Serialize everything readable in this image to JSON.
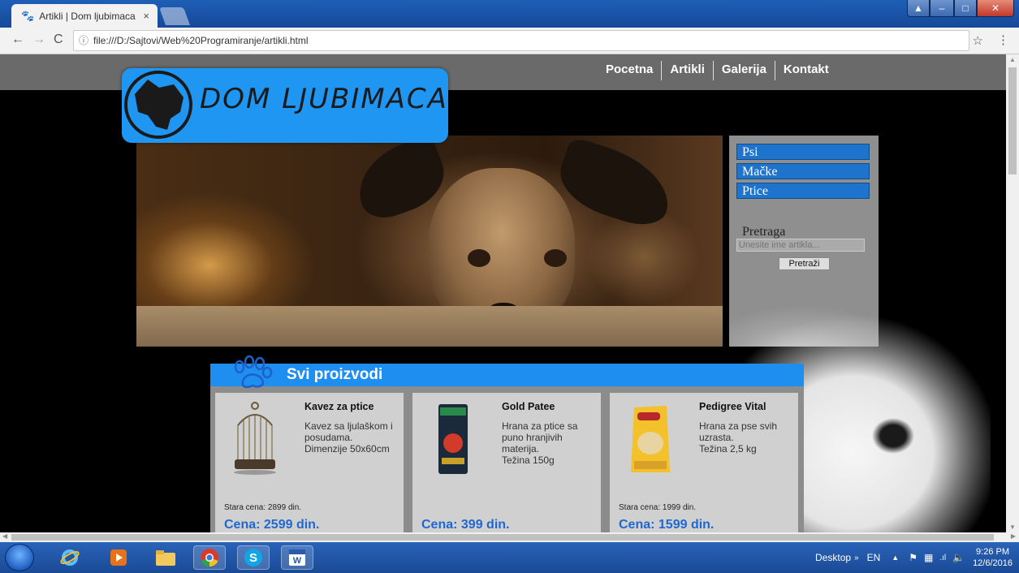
{
  "browser": {
    "tab_title": "Artikli | Dom ljubimaca",
    "url": "file:///D:/Sajtovi/Web%20Programiranje/artikli.html"
  },
  "site": {
    "nav": [
      {
        "label": "Pocetna"
      },
      {
        "label": "Artikli"
      },
      {
        "label": "Galerija"
      },
      {
        "label": "Kontakt"
      }
    ],
    "logo_text": "DOM LJUBIMACA",
    "categories": [
      {
        "label": "Psi"
      },
      {
        "label": "Mačke"
      },
      {
        "label": "Ptice"
      }
    ],
    "search": {
      "label": "Pretraga",
      "placeholder": "Unesite ime artikla...",
      "button": "Pretraži"
    },
    "products_title": "Svi proizvodi",
    "products": [
      {
        "name": "Kavez za ptice",
        "description": "Kavez sa ljulaškom i posudama.\nDimenzije 50x60cm",
        "old_price": "Stara cena: 2899 din.",
        "price": "Cena: 2599 din."
      },
      {
        "name": "Gold Patee",
        "description": "Hrana za ptice sa puno hranjivih materija.\nTežina 150g",
        "old_price": "",
        "price": "Cena: 399 din."
      },
      {
        "name": "Pedigree Vital",
        "description": "Hrana za pse svih uzrasta.\nTežina 2,5 kg",
        "old_price": "Stara cena: 1999 din.",
        "price": "Cena: 1599 din."
      }
    ],
    "colors": {
      "accent_blue": "#1e8ef0",
      "price_blue": "#1f68d1",
      "nav_gray": "#6a6a6a"
    }
  },
  "taskbar": {
    "desktop_label": "Desktop",
    "lang": "EN",
    "time": "9:26 PM",
    "date": "12/6/2016",
    "apps": [
      "internet-explorer-icon",
      "media-player-icon",
      "file-explorer-icon",
      "chrome-icon",
      "skype-icon",
      "word-icon"
    ]
  }
}
